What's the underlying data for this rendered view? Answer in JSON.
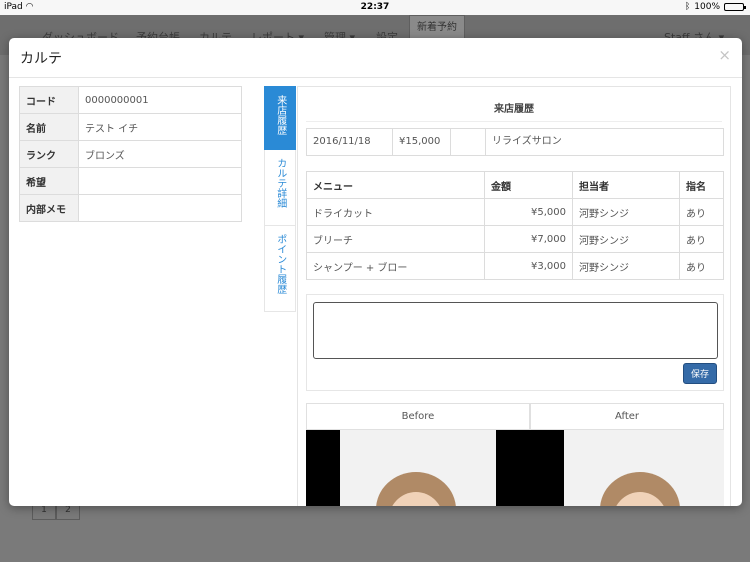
{
  "status_bar": {
    "device": "iPad",
    "time": "22:37",
    "battery": "100%",
    "battery_level": 1.0
  },
  "background": {
    "nav": [
      "ダッシュボード",
      "予約台帳",
      "カルテ",
      "レポート ▾",
      "管理 ▾",
      "設定"
    ],
    "new_reservation": "新着予約",
    "user": "Staff さん ▾",
    "pager": [
      "1",
      "2"
    ]
  },
  "modal": {
    "title": "カルテ",
    "close": "×"
  },
  "customer": {
    "rows": [
      {
        "label": "コード",
        "value": "0000000001"
      },
      {
        "label": "名前",
        "value": "テスト イチ"
      },
      {
        "label": "ランク",
        "value": "ブロンズ"
      },
      {
        "label": "希望",
        "value": ""
      },
      {
        "label": "内部メモ",
        "value": ""
      }
    ]
  },
  "tabs": [
    {
      "label": "来店履歴",
      "active": true
    },
    {
      "label": "カルテ詳細",
      "active": false
    },
    {
      "label": "ポイント履歴",
      "active": false
    }
  ],
  "visit_history": {
    "title": "来店履歴",
    "visit": {
      "date": "2016/11/18",
      "amount": "¥15,000",
      "extra": "",
      "salon": "リライズサロン"
    },
    "menu_table": {
      "headers": [
        "メニュー",
        "金額",
        "担当者",
        "指名"
      ],
      "rows": [
        [
          "ドライカット",
          "¥5,000",
          "河野シンジ",
          "あり"
        ],
        [
          "ブリーチ",
          "¥7,000",
          "河野シンジ",
          "あり"
        ],
        [
          "シャンプー + ブロー",
          "¥3,000",
          "河野シンジ",
          "あり"
        ]
      ]
    },
    "memo_value": "",
    "save_label": "保存",
    "photos": {
      "before": "Before",
      "after": "After"
    }
  }
}
